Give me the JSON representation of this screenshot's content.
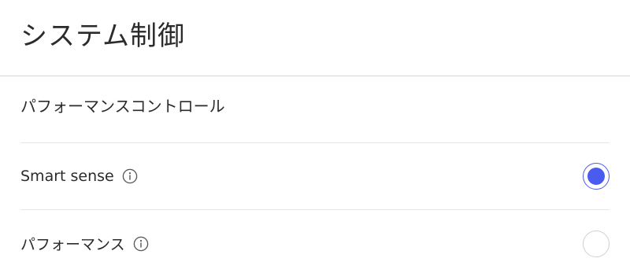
{
  "page": {
    "title": "システム制御"
  },
  "performance_control": {
    "section_title": "パフォーマンスコントロール",
    "options": [
      {
        "label": "Smart sense",
        "info_icon": "info-icon",
        "selected": true
      },
      {
        "label": "パフォーマンス",
        "info_icon": "info-icon",
        "selected": false
      }
    ]
  },
  "colors": {
    "accent": "#4a5cf0",
    "divider": "#e6e6e6",
    "text": "#2b2b2b"
  }
}
